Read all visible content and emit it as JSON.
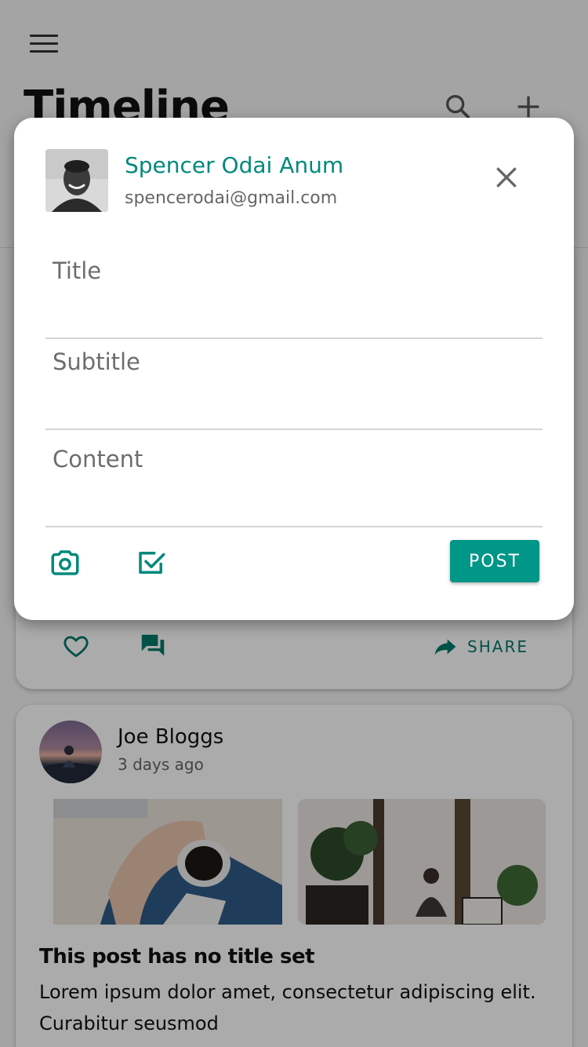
{
  "header": {
    "title": "Timeline",
    "icons": {
      "menu": "menu-icon",
      "search": "search-icon",
      "add": "add-icon"
    }
  },
  "feed": {
    "card1": {
      "actions": {
        "like_icon": "heart-outline-icon",
        "comment_icon": "comment-icon",
        "share_icon": "share-icon",
        "share_label": "SHARE"
      }
    },
    "card2": {
      "author": "Joe Bloggs",
      "time": "3 days ago",
      "title": "This post has no title set",
      "body": "Lorem ipsum dolor amet, consectetur adipiscing elit. Curabitur seusmod"
    }
  },
  "dialog": {
    "user": {
      "name": "Spencer Odai Anum",
      "email": "spencerodai@gmail.com"
    },
    "fields": {
      "title_placeholder": "Title",
      "subtitle_placeholder": "Subtitle",
      "content_placeholder": "Content"
    },
    "icons": {
      "close": "close-icon",
      "camera": "camera-icon",
      "checkbox": "checkbox-icon"
    },
    "post_label": "POST"
  },
  "colors": {
    "accent": "#009688",
    "accent_text": "#00897b",
    "overlay": "rgba(0,0,0,0.33)"
  }
}
